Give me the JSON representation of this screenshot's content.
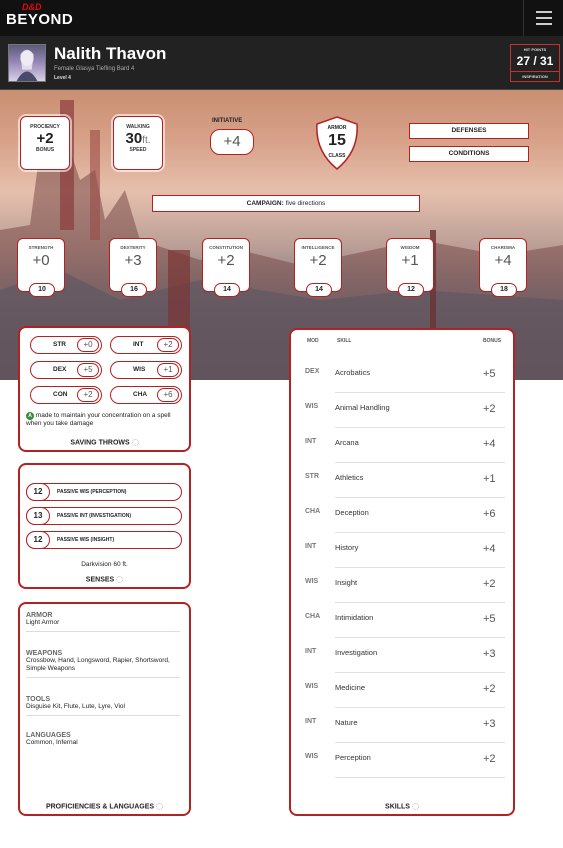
{
  "header": {
    "logo_top": "D&D",
    "logo_bottom": "BEYOND"
  },
  "character": {
    "name": "Nalith Thavon",
    "subtitle": "Female Glasya Tiefling Bard 4",
    "level": "Level 4"
  },
  "hp": {
    "label": "HIT POINTS",
    "value": "27 / 31",
    "inspiration_label": "INSPIRATION"
  },
  "stats": {
    "proficiency": {
      "label": "PROCIENCY",
      "value": "+2",
      "sub": "BONUS"
    },
    "walking": {
      "label": "WALKING",
      "value": "30",
      "unit": "ft.",
      "sub": "SPEED"
    },
    "initiative": {
      "label": "INITIATIVE",
      "value": "+4"
    },
    "armor": {
      "label": "ARMOR",
      "value": "15",
      "sub": "CLASS"
    }
  },
  "buttons": {
    "defenses": "DEFENSES",
    "conditions": "CONDITIONS"
  },
  "campaign": {
    "label": "CAMPAIGN:",
    "value": "five directions"
  },
  "abilities": [
    {
      "label": "STRENGTH",
      "mod": "+0",
      "score": "10"
    },
    {
      "label": "DEXTERITY",
      "mod": "+3",
      "score": "16"
    },
    {
      "label": "CONSTITUTION",
      "mod": "+2",
      "score": "14"
    },
    {
      "label": "INTELLIGENCE",
      "mod": "+2",
      "score": "14"
    },
    {
      "label": "WISDOM",
      "mod": "+1",
      "score": "12"
    },
    {
      "label": "CHARISMA",
      "mod": "+4",
      "score": "18"
    }
  ],
  "saves": {
    "items": [
      {
        "label": "STR",
        "value": "+0"
      },
      {
        "label": "INT",
        "value": "+2"
      },
      {
        "label": "DEX",
        "value": "+5"
      },
      {
        "label": "WIS",
        "value": "+1"
      },
      {
        "label": "CON",
        "value": "+2"
      },
      {
        "label": "CHA",
        "value": "+6"
      }
    ],
    "note": "made to maintain your concentration on a spell when you take damage",
    "title": "SAVING THROWS"
  },
  "senses": {
    "items": [
      {
        "value": "12",
        "label": "PASSIVE WIS (PERCEPTION)"
      },
      {
        "value": "13",
        "label": "PASSIVE INT (INVESTIGATION)"
      },
      {
        "value": "12",
        "label": "PASSIVE WIS (INSIGHT)"
      }
    ],
    "extra": "Darkvision 60 ft.",
    "title": "SENSES"
  },
  "proficiencies": {
    "sections": [
      {
        "heading": "ARMOR",
        "body": "Light Armor"
      },
      {
        "heading": "WEAPONS",
        "body": "Crossbow, Hand, Longsword, Rapier, Shortsword, Simple Weapons"
      },
      {
        "heading": "TOOLS",
        "body": "Disguise Kit, Flute, Lute, Lyre, Viol"
      },
      {
        "heading": "LANGUAGES",
        "body": "Common, Infernal"
      }
    ],
    "title": "PROFICIENCIES & LANGUAGES"
  },
  "skills": {
    "headers": {
      "mod": "MOD",
      "skill": "SKILL",
      "bonus": "BONUS"
    },
    "items": [
      {
        "mod": "DEX",
        "name": "Acrobatics",
        "bonus": "+5"
      },
      {
        "mod": "WIS",
        "name": "Animal Handling",
        "bonus": "+2"
      },
      {
        "mod": "INT",
        "name": "Arcana",
        "bonus": "+4"
      },
      {
        "mod": "STR",
        "name": "Athletics",
        "bonus": "+1"
      },
      {
        "mod": "CHA",
        "name": "Deception",
        "bonus": "+6"
      },
      {
        "mod": "INT",
        "name": "History",
        "bonus": "+4"
      },
      {
        "mod": "WIS",
        "name": "Insight",
        "bonus": "+2"
      },
      {
        "mod": "CHA",
        "name": "Intimidation",
        "bonus": "+5"
      },
      {
        "mod": "INT",
        "name": "Investigation",
        "bonus": "+3"
      },
      {
        "mod": "WIS",
        "name": "Medicine",
        "bonus": "+2"
      },
      {
        "mod": "INT",
        "name": "Nature",
        "bonus": "+3"
      },
      {
        "mod": "WIS",
        "name": "Perception",
        "bonus": "+2"
      }
    ],
    "title": "SKILLS"
  },
  "colors": {
    "accent": "#b22222",
    "header_bg": "#111111"
  }
}
